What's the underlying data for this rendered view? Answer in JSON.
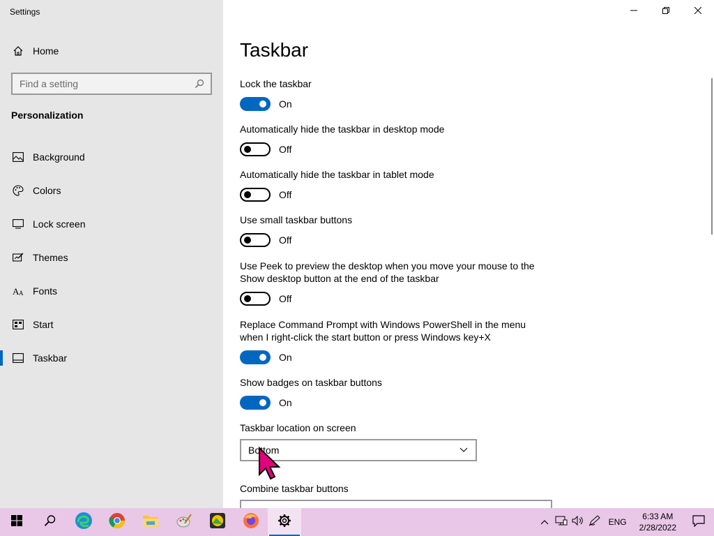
{
  "window": {
    "title": "Settings"
  },
  "sidebar": {
    "home_label": "Home",
    "search_placeholder": "Find a setting",
    "section_label": "Personalization",
    "items": [
      {
        "label": "Background",
        "icon": "picture-icon"
      },
      {
        "label": "Colors",
        "icon": "palette-icon"
      },
      {
        "label": "Lock screen",
        "icon": "lock-screen-icon"
      },
      {
        "label": "Themes",
        "icon": "themes-icon"
      },
      {
        "label": "Fonts",
        "icon": "fonts-icon"
      },
      {
        "label": "Start",
        "icon": "start-icon"
      },
      {
        "label": "Taskbar",
        "icon": "taskbar-icon",
        "active": true
      }
    ]
  },
  "main": {
    "title": "Taskbar",
    "settings": [
      {
        "label": "Lock the taskbar",
        "state": "On"
      },
      {
        "label": "Automatically hide the taskbar in desktop mode",
        "state": "Off"
      },
      {
        "label": "Automatically hide the taskbar in tablet mode",
        "state": "Off"
      },
      {
        "label": "Use small taskbar buttons",
        "state": "Off"
      },
      {
        "label": "Use Peek to preview the desktop when you move your mouse to the Show desktop button at the end of the taskbar",
        "state": "Off"
      },
      {
        "label": "Replace Command Prompt with Windows PowerShell in the menu when I right-click the start button or press Windows key+X",
        "state": "On"
      },
      {
        "label": "Show badges on taskbar buttons",
        "state": "On"
      }
    ],
    "location_label": "Taskbar location on screen",
    "location_value": "Bottom",
    "combine_label": "Combine taskbar buttons"
  },
  "taskbar": {
    "language": "ENG",
    "time": "6:33 AM",
    "date": "2/28/2022"
  },
  "colors": {
    "accent": "#0067c0",
    "taskbar": "#e9c7e7",
    "sidebar": "#e6e6e6"
  }
}
